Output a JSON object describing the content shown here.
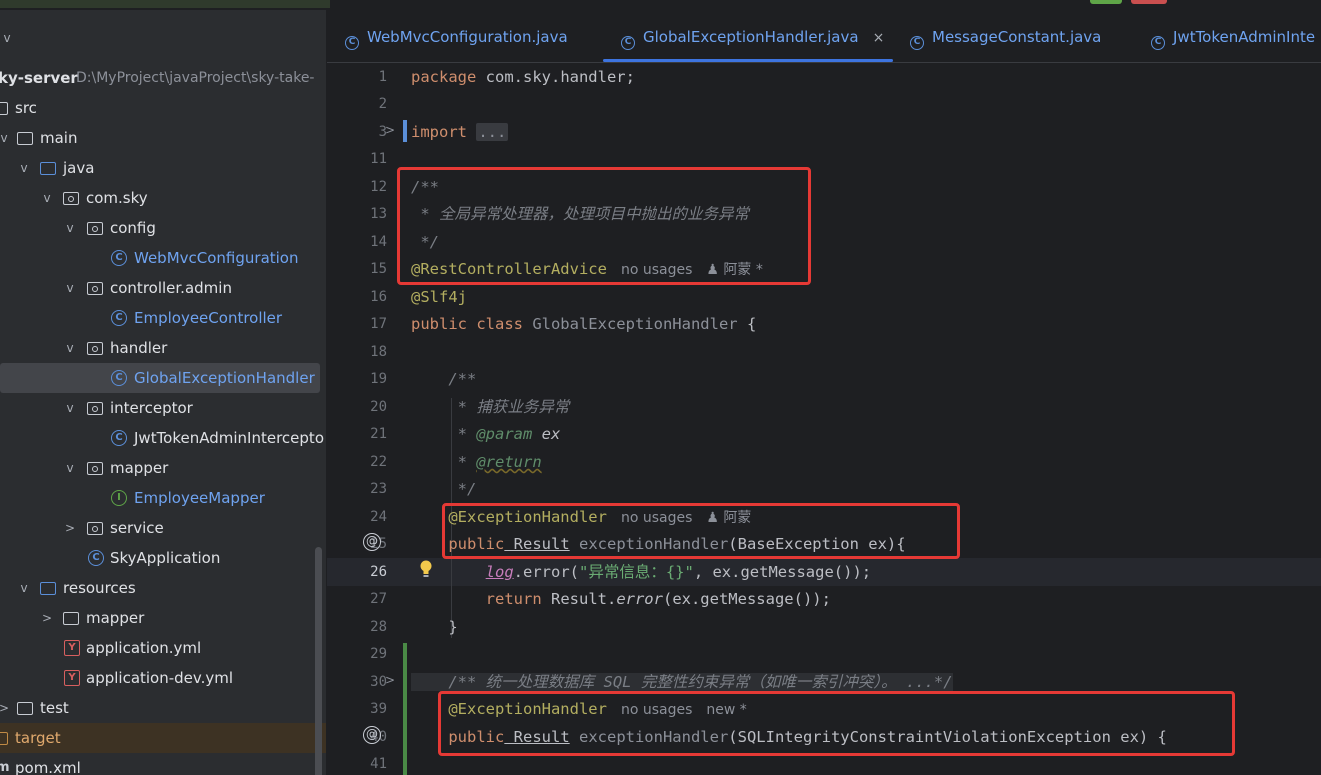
{
  "tabs": [
    {
      "label": "WebMvcConfiguration.java",
      "icon": "class-icon",
      "active": false
    },
    {
      "label": "GlobalExceptionHandler.java",
      "icon": "class-icon",
      "active": true,
      "close": "×"
    },
    {
      "label": "MessageConstant.java",
      "icon": "class-icon",
      "active": false
    },
    {
      "label": "JwtTokenAdminInte",
      "icon": "class-icon",
      "active": false
    }
  ],
  "tree": {
    "root_label": "ky-server",
    "root_path": "D:\\MyProject\\javaProject\\sky-take-",
    "items": [
      {
        "label": "src",
        "icon": "folder-icon"
      },
      {
        "label": "main",
        "icon": "folder-icon",
        "chevron": "v"
      },
      {
        "label": "java",
        "icon": "folder-icon",
        "chevron": "v"
      },
      {
        "label": "com.sky",
        "icon": "package-icon",
        "chevron": "v"
      },
      {
        "label": "config",
        "icon": "package-icon",
        "chevron": "v"
      },
      {
        "label": "WebMvcConfiguration",
        "icon": "class-icon"
      },
      {
        "label": "controller.admin",
        "icon": "package-icon",
        "chevron": "v"
      },
      {
        "label": "EmployeeController",
        "icon": "class-icon"
      },
      {
        "label": "handler",
        "icon": "package-icon",
        "chevron": "v"
      },
      {
        "label": "GlobalExceptionHandler",
        "icon": "class-icon"
      },
      {
        "label": "interceptor",
        "icon": "package-icon",
        "chevron": "v"
      },
      {
        "label": "JwtTokenAdminIntercepto",
        "icon": "class-icon"
      },
      {
        "label": "mapper",
        "icon": "package-icon",
        "chevron": "v"
      },
      {
        "label": "EmployeeMapper",
        "icon": "interface-icon"
      },
      {
        "label": "service",
        "icon": "package-icon",
        "chevron": ">"
      },
      {
        "label": "SkyApplication",
        "icon": "spring-class-icon"
      },
      {
        "label": "resources",
        "icon": "folder-icon",
        "chevron": "v"
      },
      {
        "label": "mapper",
        "icon": "folder-icon",
        "chevron": ">"
      },
      {
        "label": "application.yml",
        "icon": "yaml-icon"
      },
      {
        "label": "application-dev.yml",
        "icon": "yaml-icon"
      },
      {
        "label": "test",
        "icon": "folder-icon"
      },
      {
        "label": "target",
        "icon": "folder-icon"
      },
      {
        "label": "pom.xml",
        "icon": "maven-icon"
      }
    ]
  },
  "editor": {
    "gutter": [
      "1",
      "2",
      "3",
      "11",
      "12",
      "13",
      "14",
      "15",
      "16",
      "17",
      "18",
      "19",
      "20",
      "21",
      "22",
      "23",
      "24",
      "25",
      "26",
      "27",
      "28",
      "29",
      "30",
      "39",
      "40",
      "41"
    ],
    "current_line": "26",
    "hints": {
      "no_usages": "no usages",
      "author": "阿蒙",
      "star": "*",
      "new": "new"
    },
    "code": {
      "l1_kw": "package",
      "l1_rest": " com.sky.handler;",
      "l3_kw": "import",
      "l3_dots": "...",
      "l12": "/**",
      "l13": " * 全局异常处理器，处理项目中抛出的业务异常",
      "l14": " */",
      "l15": "@RestControllerAdvice",
      "l16": "@Slf4j",
      "l17_kw": "public class",
      "l17_name": " GlobalExceptionHandler",
      "l17_end": " {",
      "l19": "    /**",
      "l20": "     * 捕获业务异常",
      "l21_pre": "     * ",
      "l21_tag": "@param",
      "l21_arg": " ex",
      "l22_pre": "     * ",
      "l22_tag": "@return",
      "l23": "     */",
      "l24": "    @ExceptionHandler",
      "l25_kw": "    public",
      "l25_type": " Result",
      "l25_fn": " exceptionHandler",
      "l25_rest": "(BaseException ex){",
      "l26_pre": "        ",
      "l26_log": "log",
      "l26_a": ".error(",
      "l26_str": "\"异常信息：{}\"",
      "l26_b": ", ex.getMessage());",
      "l27_kw": "        return",
      "l27_a": " Result.",
      "l27_fn": "error",
      "l27_b": "(ex.getMessage());",
      "l28": "    }",
      "l30": "    /** 统一处理数据库 SQL 完整性约束异常（如唯一索引冲突）。 ...*/",
      "l39": "    @ExceptionHandler",
      "l40_kw": "    public",
      "l40_type": " Result",
      "l40_fn": " exceptionHandler",
      "l40_rest": "(SQLIntegrityConstraintViolationException ex) {"
    }
  }
}
